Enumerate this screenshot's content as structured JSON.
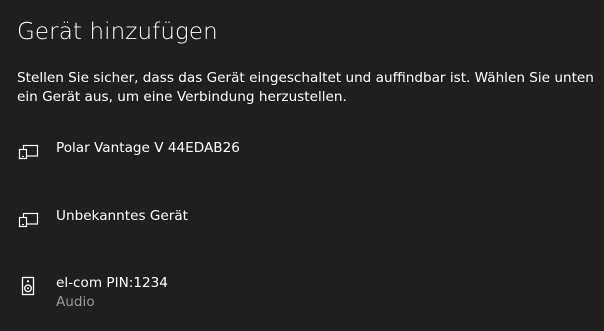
{
  "dialog": {
    "title": "Gerät hinzufügen",
    "description": "Stellen Sie sicher, dass das Gerät eingeschaltet und auffindbar ist. Wählen Sie unten ein Gerät aus, um eine Verbindung herzustellen."
  },
  "devices": [
    {
      "name": "Polar Vantage V 44EDAB26",
      "subtitle": "",
      "icon": "device-generic-icon"
    },
    {
      "name": "Unbekanntes Gerät",
      "subtitle": "",
      "icon": "device-generic-icon"
    },
    {
      "name": "el-com PIN:1234",
      "subtitle": "Audio",
      "icon": "speaker-icon"
    }
  ]
}
